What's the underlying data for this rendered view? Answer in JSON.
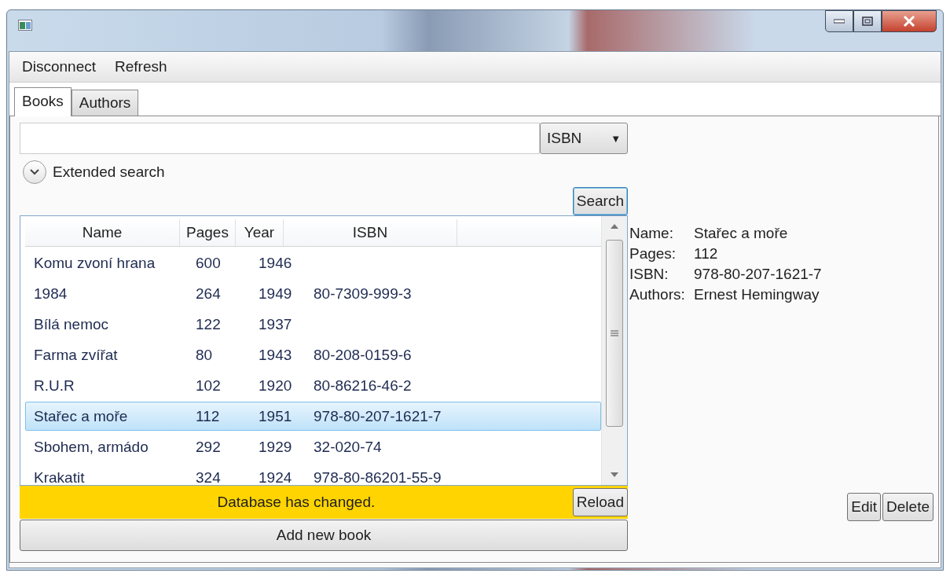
{
  "menu": [
    "Disconnect",
    "Refresh"
  ],
  "tabs": [
    {
      "label": "Books",
      "selected": true
    },
    {
      "label": "Authors",
      "selected": false
    }
  ],
  "search": {
    "combo": "ISBN",
    "combo_arrow": "▼",
    "expander": "Extended search",
    "expanded": false,
    "button": "Search"
  },
  "table": {
    "columns": [
      "Name",
      "Pages",
      "Year",
      "ISBN"
    ],
    "rows": [
      {
        "cells": [
          "Komu zvoní hrana",
          "600",
          "1946",
          ""
        ],
        "selected": false
      },
      {
        "cells": [
          "1984",
          "264",
          "1949",
          "80-7309-999-3"
        ],
        "selected": false
      },
      {
        "cells": [
          "Bílá nemoc",
          "122",
          "1937",
          ""
        ],
        "selected": false
      },
      {
        "cells": [
          "Farma zvířat",
          "80",
          "1943",
          "80-208-0159-6"
        ],
        "selected": false
      },
      {
        "cells": [
          "R.U.R",
          "102",
          "1920",
          "80-86216-46-2"
        ],
        "selected": false
      },
      {
        "cells": [
          "Stařec a moře",
          "112",
          "1951",
          "978-80-207-1621-7"
        ],
        "selected": true
      },
      {
        "cells": [
          "Sbohem, armádo",
          "292",
          "1929",
          "32-020-74"
        ],
        "selected": false
      },
      {
        "cells": [
          "Krakatit",
          "324",
          "1924",
          "978-80-86201-55-9"
        ],
        "selected": false
      }
    ]
  },
  "notice": {
    "message": "Database has changed.",
    "button": "Reload"
  },
  "add_button": "Add new book",
  "details": [
    {
      "label": "Name:",
      "value": "Stařec a moře"
    },
    {
      "label": "Pages:",
      "value": "112"
    },
    {
      "label": "ISBN:",
      "value": "978-80-207-1621-7"
    },
    {
      "label": "Authors:",
      "value": "Ernest Hemingway"
    }
  ],
  "detail_buttons": [
    "Edit",
    "Delete"
  ]
}
